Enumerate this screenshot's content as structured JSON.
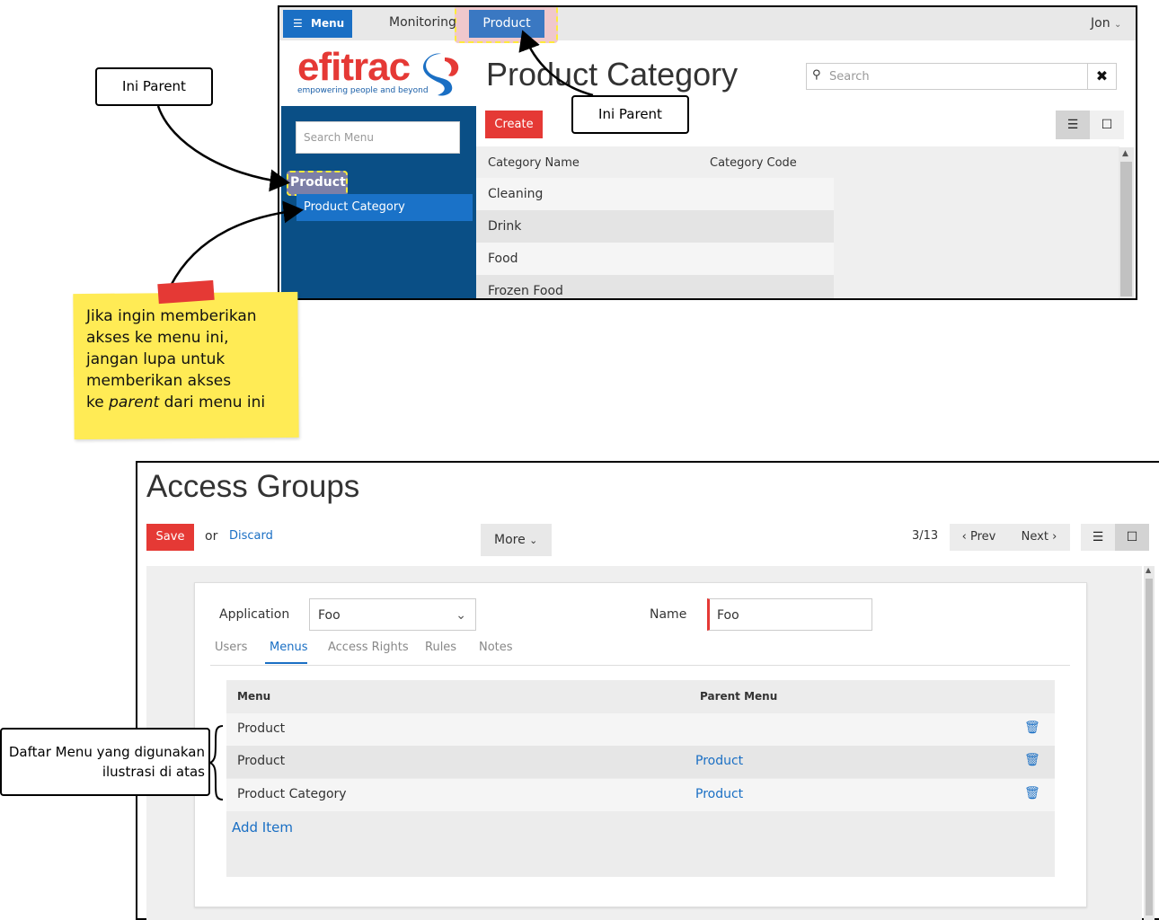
{
  "top_app": {
    "menu_label": "Menu",
    "nav_items": [
      "Monitoring",
      "Product"
    ],
    "user": "Jon",
    "logo": {
      "brand": "efitrac",
      "tagline": "empowering people and beyond"
    },
    "sidebar": {
      "search_placeholder": "Search Menu",
      "parent_item": "Product",
      "child_item": "Product Category"
    },
    "page_title": "Product Category",
    "search_placeholder": "Search",
    "create_label": "Create",
    "list": {
      "columns": [
        "Category Name",
        "Category Code"
      ],
      "rows": [
        "Cleaning",
        "Drink",
        "Food",
        "Frozen Food"
      ]
    }
  },
  "annotations": {
    "parent_callout_1": "Ini Parent",
    "parent_callout_2": "Ini Parent",
    "note_lines": [
      "Jika ingin memberikan",
      "akses ke menu ini,",
      "jangan lupa untuk",
      "memberikan akses",
      "ke parent dari menu ini"
    ],
    "daftar_menu": [
      "Daftar Menu yang digunakan",
      "ilustrasi di atas"
    ]
  },
  "bottom_app": {
    "page_title": "Access Groups",
    "save_label": "Save",
    "or_text": "or",
    "discard_label": "Discard",
    "more_label": "More",
    "pager": {
      "count": "3/13",
      "prev": "Prev",
      "next": "Next"
    },
    "form": {
      "application_label": "Application",
      "application_value": "Foo",
      "name_label": "Name",
      "name_value": "Foo"
    },
    "tabs": [
      "Users",
      "Menus",
      "Access Rights",
      "Rules",
      "Notes"
    ],
    "active_tab": "Menus",
    "menus_grid": {
      "columns": [
        "Menu",
        "Parent Menu"
      ],
      "rows": [
        {
          "menu": "Product",
          "parent": ""
        },
        {
          "menu": "Product",
          "parent": "Product"
        },
        {
          "menu": "Product Category",
          "parent": "Product"
        }
      ],
      "add_item_label": "Add Item"
    }
  },
  "colors": {
    "accent_blue": "#1a6fc4",
    "sidebar_blue": "#0a4f86",
    "danger_red": "#e53935",
    "note_yellow": "#ffeb55"
  }
}
